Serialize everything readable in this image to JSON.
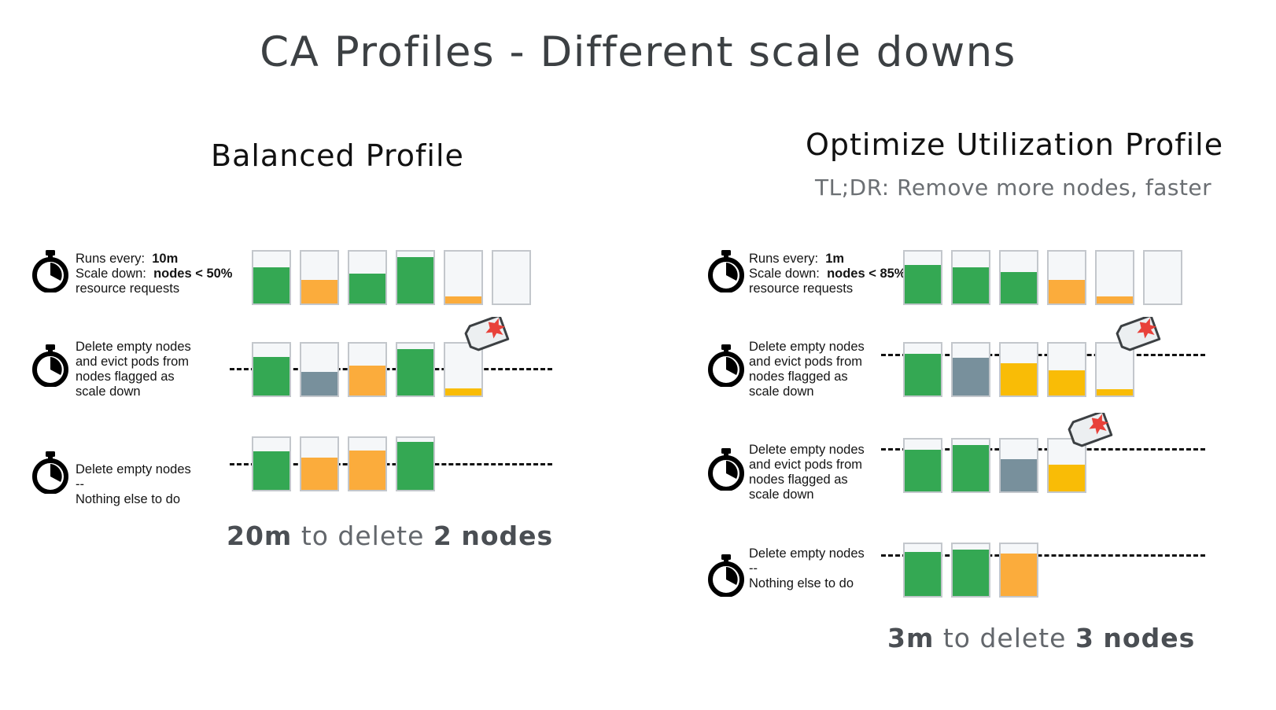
{
  "slide": {
    "title": "CA Profiles - Different scale downs",
    "background": "#ffffff"
  },
  "colors": {
    "green": "#34a853",
    "orange": "#fbac3c",
    "amber": "#f9bc06",
    "slate": "#78909c",
    "empty": "#f5f7f9",
    "node_border": "#c3c7cc",
    "dashed_line": "#111111",
    "title_text": "#3c4043",
    "subtitle_text": "#6b6f73",
    "tag_mark": "#e8413a"
  },
  "columns": {
    "left": {
      "heading": "Balanced Profile",
      "caption_time": "20m",
      "caption_middle": "to delete",
      "caption_count": "2",
      "caption_tail": "nodes",
      "steps": [
        {
          "icon": "stopwatch-icon",
          "lines": [
            {
              "label": "Runs every:",
              "value": "10m"
            },
            {
              "label": "Scale down:",
              "value": "nodes < 50%"
            },
            {
              "label": "resource requests",
              "value": ""
            }
          ],
          "threshold_visible": false,
          "nodes": [
            {
              "fill": 70,
              "color": "green",
              "tagged": false
            },
            {
              "fill": 45,
              "color": "orange",
              "tagged": false
            },
            {
              "fill": 58,
              "color": "green",
              "tagged": false
            },
            {
              "fill": 90,
              "color": "green",
              "tagged": false
            },
            {
              "fill": 14,
              "color": "orange",
              "tagged": false
            },
            {
              "fill": 0,
              "color": "empty",
              "tagged": false
            }
          ]
        },
        {
          "icon": "stopwatch-icon",
          "lines": [
            {
              "label": "Delete empty nodes",
              "value": ""
            },
            {
              "label": "and evict pods from",
              "value": ""
            },
            {
              "label": "nodes flagged as",
              "value": ""
            },
            {
              "label": "scale down",
              "value": ""
            }
          ],
          "threshold_visible": true,
          "nodes": [
            {
              "fill": 75,
              "color": "green",
              "tagged": false
            },
            {
              "fill": 45,
              "color": "slate",
              "tagged": false
            },
            {
              "fill": 58,
              "color": "orange",
              "tagged": false
            },
            {
              "fill": 90,
              "color": "green",
              "tagged": false
            },
            {
              "fill": 13,
              "color": "amber",
              "tagged": true
            }
          ]
        },
        {
          "icon": "stopwatch-icon",
          "lines": [
            {
              "label": "Delete empty nodes",
              "value": ""
            },
            {
              "label": "--",
              "value": ""
            },
            {
              "label": "Nothing else to do",
              "value": ""
            }
          ],
          "threshold_visible": true,
          "nodes": [
            {
              "fill": 74,
              "color": "green",
              "tagged": false
            },
            {
              "fill": 62,
              "color": "orange",
              "tagged": false
            },
            {
              "fill": 76,
              "color": "orange",
              "tagged": false
            },
            {
              "fill": 92,
              "color": "green",
              "tagged": false
            }
          ]
        }
      ]
    },
    "right": {
      "heading": "Optimize Utilization Profile",
      "subheading": "TL;DR: Remove more nodes, faster",
      "caption_time": "3m",
      "caption_middle": "to delete",
      "caption_count": "3",
      "caption_tail": "nodes",
      "steps": [
        {
          "icon": "stopwatch-icon",
          "lines": [
            {
              "label": "Runs every:",
              "value": "1m"
            },
            {
              "label": "Scale down:",
              "value": "nodes < 85%"
            },
            {
              "label": "resource requests",
              "value": ""
            }
          ],
          "threshold_visible": false,
          "nodes": [
            {
              "fill": 74,
              "color": "green",
              "tagged": false
            },
            {
              "fill": 70,
              "color": "green",
              "tagged": false
            },
            {
              "fill": 60,
              "color": "green",
              "tagged": false
            },
            {
              "fill": 45,
              "color": "orange",
              "tagged": false
            },
            {
              "fill": 14,
              "color": "orange",
              "tagged": false
            },
            {
              "fill": 0,
              "color": "empty",
              "tagged": false
            }
          ]
        },
        {
          "icon": "stopwatch-icon",
          "lines": [
            {
              "label": "Delete empty nodes",
              "value": ""
            },
            {
              "label": "and evict pods from",
              "value": ""
            },
            {
              "label": "nodes flagged as",
              "value": ""
            },
            {
              "label": "scale down",
              "value": ""
            }
          ],
          "threshold_visible": true,
          "nodes": [
            {
              "fill": 80,
              "color": "green",
              "tagged": false
            },
            {
              "fill": 72,
              "color": "slate",
              "tagged": false
            },
            {
              "fill": 62,
              "color": "amber",
              "tagged": false
            },
            {
              "fill": 48,
              "color": "amber",
              "tagged": false
            },
            {
              "fill": 12,
              "color": "amber",
              "tagged": true
            }
          ]
        },
        {
          "icon": "stopwatch-icon",
          "lines": [
            {
              "label": "Delete empty nodes",
              "value": ""
            },
            {
              "label": "and evict pods from",
              "value": ""
            },
            {
              "label": "nodes flagged as",
              "value": ""
            },
            {
              "label": "scale down",
              "value": ""
            }
          ],
          "threshold_visible": true,
          "nodes": [
            {
              "fill": 80,
              "color": "green",
              "tagged": false
            },
            {
              "fill": 90,
              "color": "green",
              "tagged": false
            },
            {
              "fill": 62,
              "color": "slate",
              "tagged": false
            },
            {
              "fill": 52,
              "color": "amber",
              "tagged": true
            }
          ]
        },
        {
          "icon": "stopwatch-icon",
          "lines": [
            {
              "label": "Delete empty nodes",
              "value": ""
            },
            {
              "label": "--",
              "value": ""
            },
            {
              "label": "Nothing else to do",
              "value": ""
            }
          ],
          "threshold_visible": true,
          "nodes": [
            {
              "fill": 85,
              "color": "green",
              "tagged": false
            },
            {
              "fill": 90,
              "color": "green",
              "tagged": false
            },
            {
              "fill": 82,
              "color": "orange",
              "tagged": false
            }
          ]
        }
      ]
    }
  }
}
